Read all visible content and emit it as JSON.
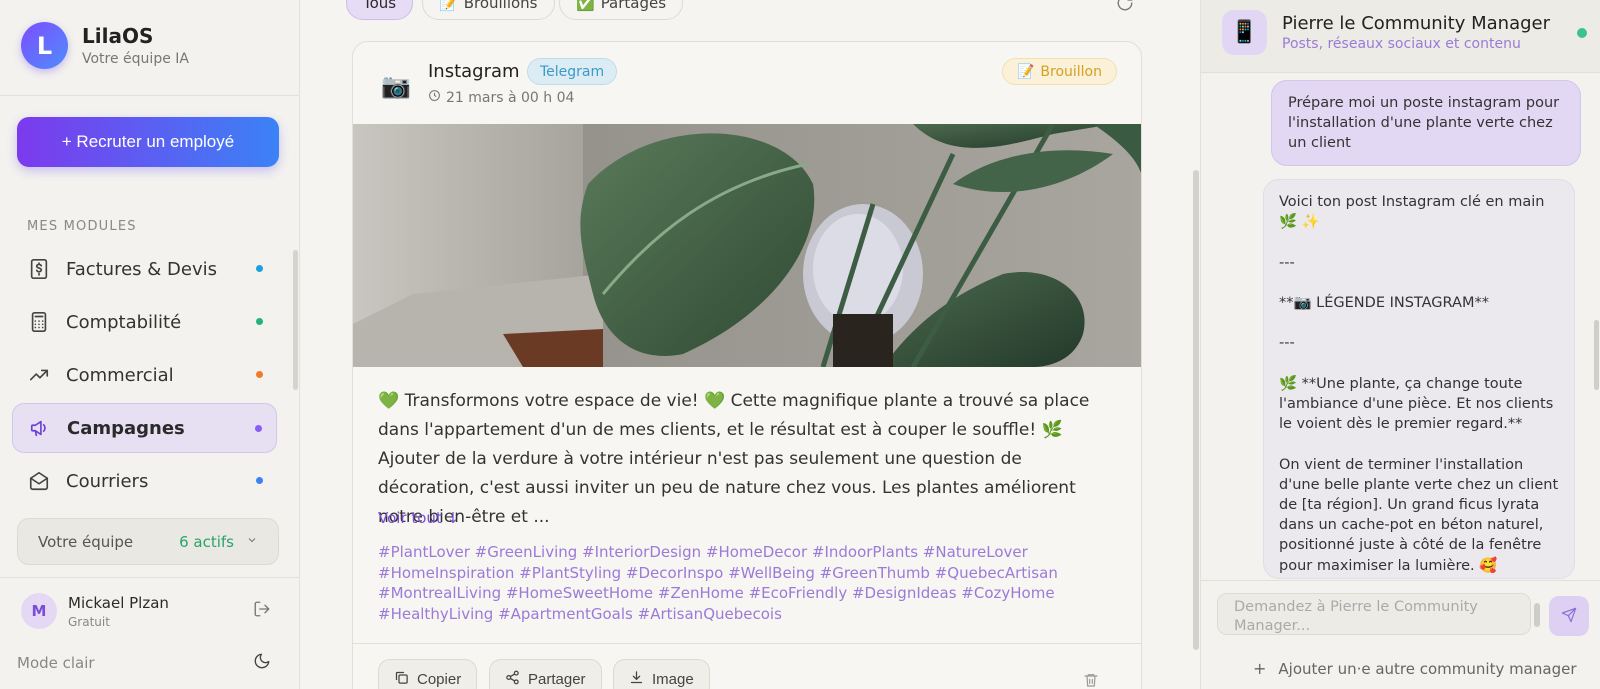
{
  "brand": {
    "name": "LilaOS",
    "subtitle": "Votre équipe IA",
    "logo_letter": "L"
  },
  "sidebar": {
    "recruit_button": "+ Recruter un employé",
    "modules_title": "MES MODULES",
    "items": [
      {
        "label": "Factures & Devis",
        "icon": "dollar-icon",
        "dot_color": "#1ea0e0",
        "active": false
      },
      {
        "label": "Comptabilité",
        "icon": "calculator-icon",
        "dot_color": "#22b27a",
        "active": false
      },
      {
        "label": "Commercial",
        "icon": "trending-up-icon",
        "dot_color": "#f07a2a",
        "active": false
      },
      {
        "label": "Campagnes",
        "icon": "megaphone-icon",
        "dot_color": "#8b5cf6",
        "active": true
      },
      {
        "label": "Courriers",
        "icon": "envelope-icon",
        "dot_color": "#3b82f6",
        "active": false
      }
    ],
    "team": {
      "label": "Votre équipe",
      "count": "6 actifs"
    },
    "user": {
      "initial": "M",
      "name": "Mickael Plzan",
      "plan": "Gratuit"
    },
    "mode_label": "Mode clair"
  },
  "filters": [
    {
      "label": "Tous",
      "icon": "",
      "active": true
    },
    {
      "label": "Brouillons",
      "icon": "📝",
      "active": false
    },
    {
      "label": "Partagés",
      "icon": "✅",
      "active": false
    }
  ],
  "post": {
    "platform": "Instagram",
    "platform_icon": "📷",
    "channel": "Telegram",
    "date": "21 mars à 00 h 04",
    "status": "Brouillon",
    "status_icon": "📝",
    "body": "💚 Transformons votre espace de vie! 💚 Cette magnifique plante a trouvé sa place dans l'appartement d'un de mes clients, et le résultat est à couper le souffle! 🌿 Ajouter de la verdure à votre intérieur n'est pas seulement une question de décoration, c'est aussi inviter un peu de nature chez vous. Les plantes améliorent notre bien-être et ...",
    "see_all": "Voir tout ↓",
    "hashtags": "#PlantLover #GreenLiving #InteriorDesign #HomeDecor #IndoorPlants #NatureLover #HomeInspiration #PlantStyling #DecorInspo #WellBeing #GreenThumb #QuebecArtisan #MontrealLiving #HomeSweetHome #ZenHome #EcoFriendly #DesignIdeas #CozyHome #HealthyLiving #ApartmentGoals #ArtisanQuebecois",
    "actions": {
      "copy": "Copier",
      "share": "Partager",
      "image": "Image"
    }
  },
  "chat": {
    "agent_name": "Pierre le Community Manager",
    "agent_role": "Posts, réseaux sociaux et contenu",
    "agent_icon": "📱",
    "user_message": "Prépare moi un poste instagram pour l'installation d'une plante verte chez un client",
    "bot_message": "Voici ton post Instagram clé en main 🌿 ✨\n\n---\n\n**📷 LÉGENDE INSTAGRAM**\n\n---\n\n🌿 **Une plante, ça change toute l'ambiance d'une pièce. Et nos clients le voient dès le premier regard.**\n\nOn vient de terminer l'installation d'une belle plante verte chez un client de [ta région]. Un grand ficus lyrata dans un cache-pot en béton naturel, positionné juste à côté de la fenêtre pour maximiser la lumière. 🥰",
    "input_placeholder": "Demandez à Pierre le Community Manager...",
    "add_manager": "Ajouter un·e autre community manager"
  }
}
